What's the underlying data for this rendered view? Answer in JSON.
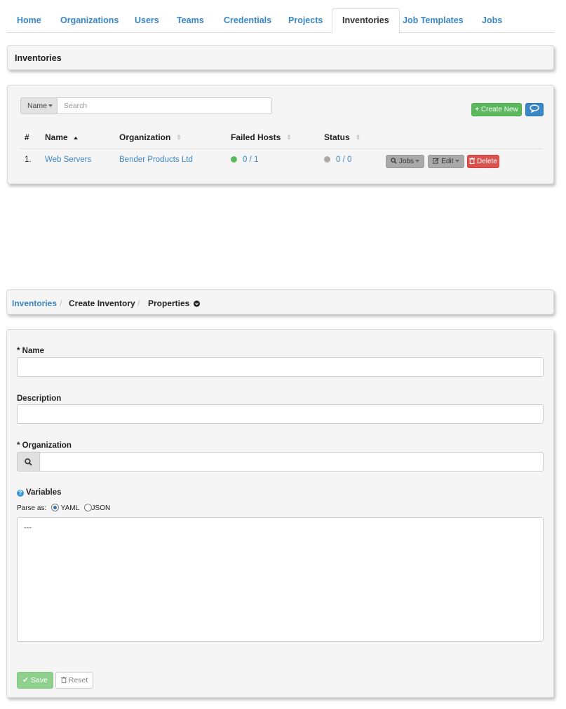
{
  "nav": {
    "tabs": [
      {
        "label": "Home"
      },
      {
        "label": "Organizations"
      },
      {
        "label": "Users"
      },
      {
        "label": "Teams"
      },
      {
        "label": "Credentials"
      },
      {
        "label": "Projects"
      },
      {
        "label": "Inventories",
        "active": true
      },
      {
        "label": "Job Templates"
      },
      {
        "label": "Jobs"
      }
    ]
  },
  "list": {
    "title": "Inventories",
    "search": {
      "field": "Name",
      "placeholder": "Search"
    },
    "create_label": "Create New",
    "columns": {
      "num": "#",
      "name": "Name",
      "organization": "Organization",
      "failed_hosts": "Failed Hosts",
      "status": "Status"
    },
    "rows": [
      {
        "num": "1.",
        "name": "Web Servers",
        "organization": "Bender Products Ltd",
        "failed_hosts": "0 / 1",
        "status": "0 / 0",
        "actions": {
          "jobs": "Jobs",
          "edit": "Edit",
          "delete": "Delete"
        }
      }
    ]
  },
  "breadcrumb": {
    "root": "Inventories",
    "sep": "/",
    "current": "Create Inventory",
    "properties": "Properties"
  },
  "form": {
    "name_label": "* Name",
    "name_value": "",
    "description_label": "Description",
    "description_value": "",
    "organization_label": "* Organization",
    "organization_value": "",
    "variables_label": "Variables",
    "parse_label": "Parse as:",
    "parse_yaml": "YAML",
    "parse_json": "JSON",
    "parse_selected": "YAML",
    "variables_value": "---",
    "save_label": "Save",
    "reset_label": "Reset"
  },
  "colors": {
    "link": "#3a87c8",
    "success": "#5cb85c",
    "danger": "#d9534f",
    "status_ok": "#5cb85c",
    "status_none": "#aaaaaa"
  }
}
